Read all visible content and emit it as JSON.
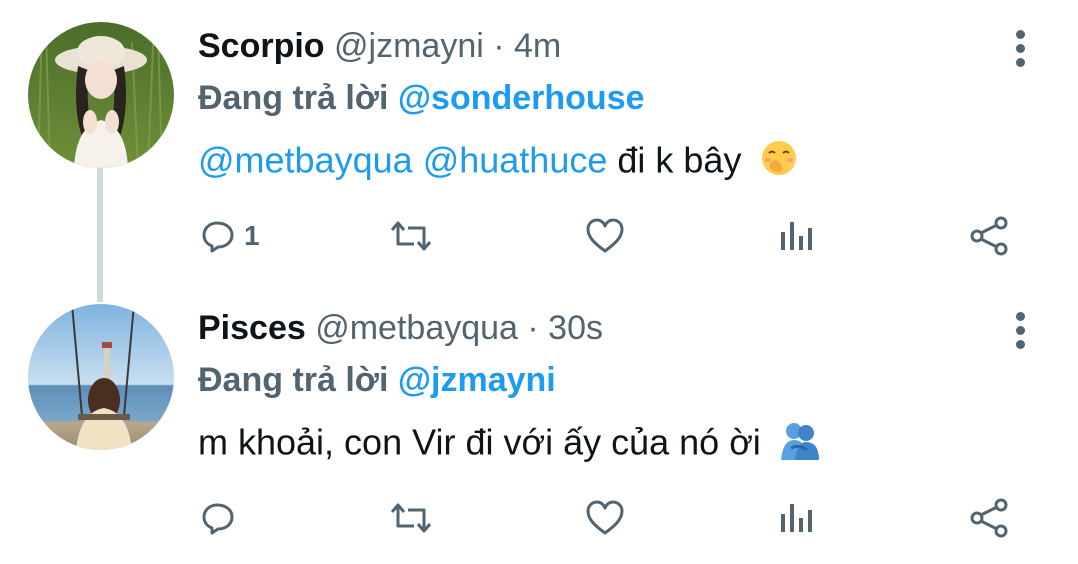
{
  "colors": {
    "accent": "#1d9bf0",
    "secondary_text": "#536471",
    "primary_text": "#0f1419",
    "thread_line": "#cfd9de"
  },
  "tweets": [
    {
      "name": "Scorpio",
      "meta": "@jzmayni · 4m",
      "reply_prefix": "Đang trả lời",
      "reply_to": "@sonderhouse",
      "mentions": [
        "@metbayqua",
        "@huathuce"
      ],
      "text": "đi k bây",
      "emoji_icon": "face-with-hand-over-mouth-emoji",
      "reply_count": "1"
    },
    {
      "name": "Pisces",
      "meta": "@metbayqua · 30s",
      "reply_prefix": "Đang trả lời",
      "reply_to": "@jzmayni",
      "text": "m khoải, con Vir đi với ấy của nó ời",
      "emoji_icon": "people-hugging-emoji",
      "reply_count": ""
    }
  ],
  "icons": {
    "more": "more-vertical-icon",
    "reply": "reply-icon",
    "retweet": "retweet-icon",
    "like": "like-icon",
    "views": "views-icon",
    "share": "share-icon"
  }
}
